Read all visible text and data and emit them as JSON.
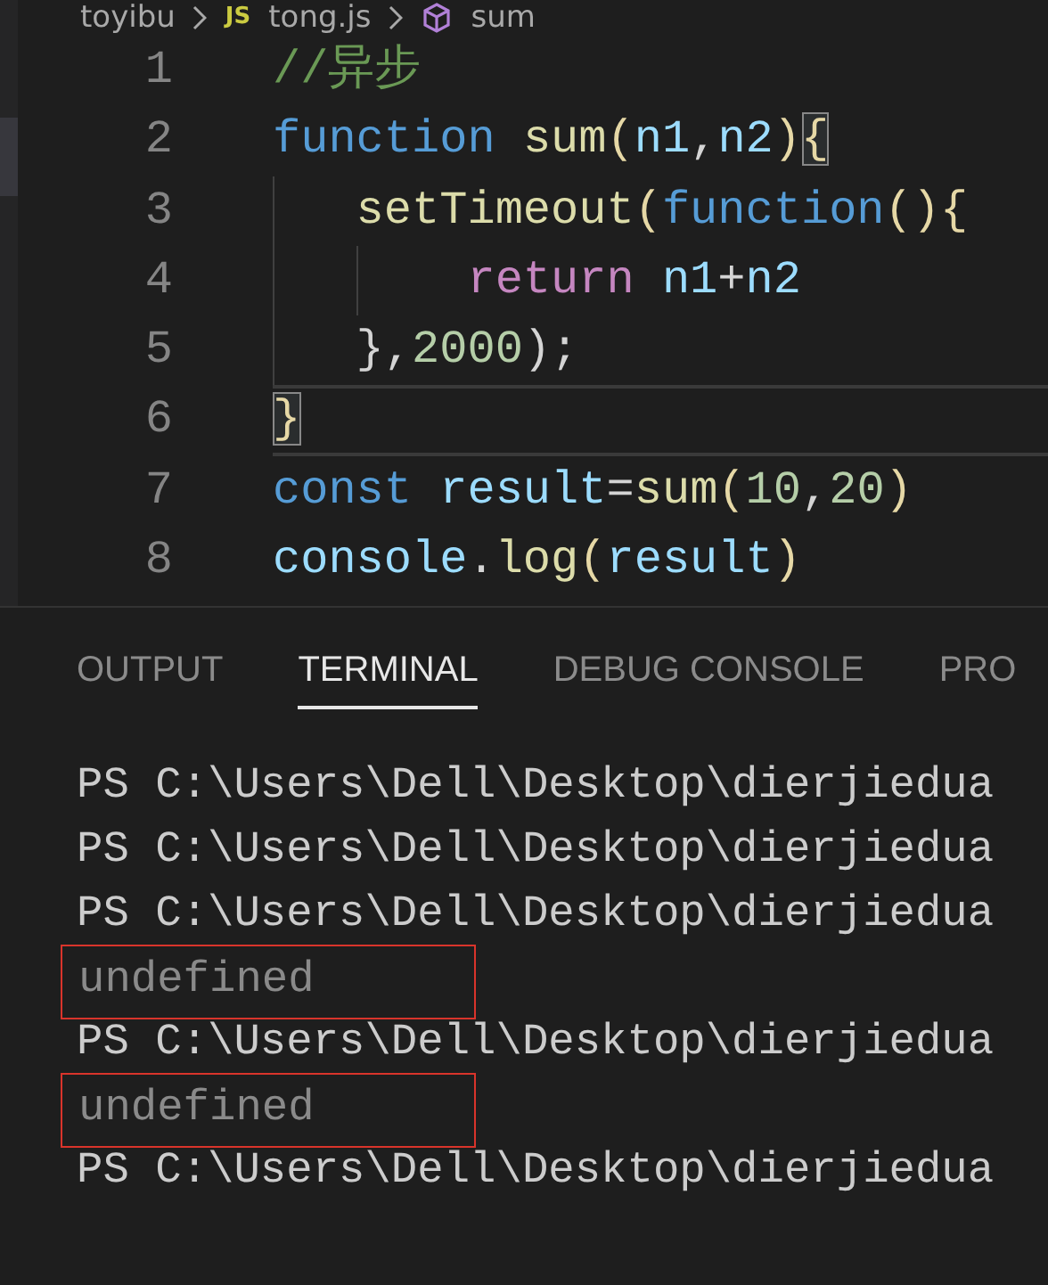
{
  "breadcrumb": {
    "folder": "toyibu",
    "file_icon": "JS",
    "file": "tong.js",
    "symbol": "sum"
  },
  "editor": {
    "lines": [
      {
        "number": "1",
        "current": false,
        "tokens": [
          {
            "text": "//异步",
            "kind": "comment",
            "matched": false
          }
        ]
      },
      {
        "number": "2",
        "current": false,
        "tokens": [
          {
            "text": "function ",
            "kind": "keyword",
            "matched": false
          },
          {
            "text": "sum",
            "kind": "func",
            "matched": false
          },
          {
            "text": "(",
            "kind": "bracket",
            "matched": false
          },
          {
            "text": "n1",
            "kind": "param",
            "matched": false
          },
          {
            "text": ",",
            "kind": "punct",
            "matched": false
          },
          {
            "text": "n2",
            "kind": "param",
            "matched": false
          },
          {
            "text": ")",
            "kind": "bracket",
            "matched": false
          },
          {
            "text": "{",
            "kind": "bracket",
            "matched": true
          }
        ]
      },
      {
        "number": "3",
        "current": false,
        "tokens": [
          {
            "text": "   setTimeout",
            "kind": "func",
            "matched": false
          },
          {
            "text": "(",
            "kind": "bracket",
            "matched": false
          },
          {
            "text": "function",
            "kind": "keyword",
            "matched": false
          },
          {
            "text": "(){",
            "kind": "bracket",
            "matched": false
          }
        ]
      },
      {
        "number": "4",
        "current": false,
        "tokens": [
          {
            "text": "       return ",
            "kind": "control",
            "matched": false
          },
          {
            "text": "n1",
            "kind": "param",
            "matched": false
          },
          {
            "text": "+",
            "kind": "punct",
            "matched": false
          },
          {
            "text": "n2",
            "kind": "param",
            "matched": false
          }
        ]
      },
      {
        "number": "5",
        "current": false,
        "tokens": [
          {
            "text": "   },",
            "kind": "punct",
            "matched": false
          },
          {
            "text": "2000",
            "kind": "number",
            "matched": false
          },
          {
            "text": ");",
            "kind": "punct",
            "matched": false
          }
        ]
      },
      {
        "number": "6",
        "current": true,
        "tokens": [
          {
            "text": "}",
            "kind": "bracket",
            "matched": true
          }
        ]
      },
      {
        "number": "7",
        "current": false,
        "tokens": [
          {
            "text": "const ",
            "kind": "keyword",
            "matched": false
          },
          {
            "text": "result",
            "kind": "param",
            "matched": false
          },
          {
            "text": "=",
            "kind": "punct",
            "matched": false
          },
          {
            "text": "sum",
            "kind": "func",
            "matched": false
          },
          {
            "text": "(",
            "kind": "bracket",
            "matched": false
          },
          {
            "text": "10",
            "kind": "number",
            "matched": false
          },
          {
            "text": ",",
            "kind": "punct",
            "matched": false
          },
          {
            "text": "20",
            "kind": "number",
            "matched": false
          },
          {
            "text": ")",
            "kind": "bracket",
            "matched": false
          }
        ]
      },
      {
        "number": "8",
        "current": false,
        "tokens": [
          {
            "text": "console",
            "kind": "param",
            "matched": false
          },
          {
            "text": ".",
            "kind": "punct",
            "matched": false
          },
          {
            "text": "log",
            "kind": "func",
            "matched": false
          },
          {
            "text": "(",
            "kind": "bracket",
            "matched": false
          },
          {
            "text": "result",
            "kind": "param",
            "matched": false
          },
          {
            "text": ")",
            "kind": "bracket",
            "matched": false
          }
        ]
      }
    ]
  },
  "panel": {
    "tabs": [
      {
        "label": "OUTPUT",
        "selected": false
      },
      {
        "label": "TERMINAL",
        "selected": true
      },
      {
        "label": "DEBUG CONSOLE",
        "selected": false
      },
      {
        "label": "PRO",
        "selected": false
      }
    ],
    "terminal_lines": [
      {
        "text": "PS C:\\Users\\Dell\\Desktop\\dierjiedua",
        "kind": "prompt",
        "boxed": false
      },
      {
        "text": "PS C:\\Users\\Dell\\Desktop\\dierjiedua",
        "kind": "prompt",
        "boxed": false
      },
      {
        "text": "PS C:\\Users\\Dell\\Desktop\\dierjiedua",
        "kind": "prompt",
        "boxed": false
      },
      {
        "text": "undefined",
        "kind": "output",
        "boxed": true
      },
      {
        "text": "PS C:\\Users\\Dell\\Desktop\\dierjiedua",
        "kind": "prompt",
        "boxed": false
      },
      {
        "text": "undefined",
        "kind": "output",
        "boxed": true
      },
      {
        "text": "PS C:\\Users\\Dell\\Desktop\\dierjiedua",
        "kind": "prompt",
        "boxed": false
      }
    ]
  }
}
